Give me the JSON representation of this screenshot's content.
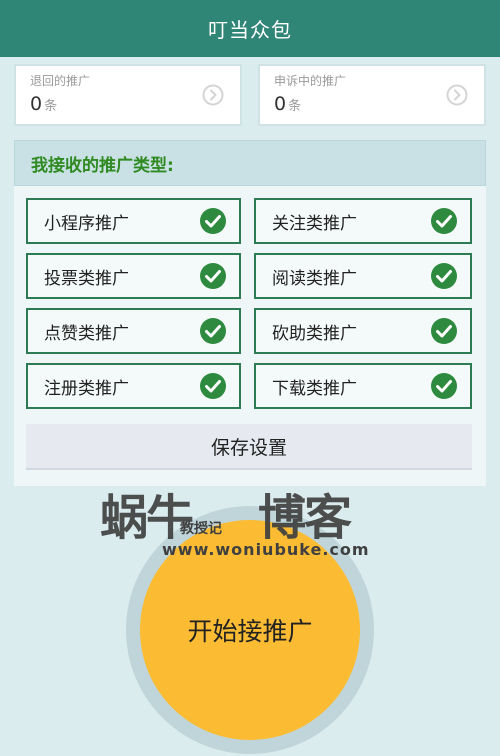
{
  "app": {
    "title": "叮当众包"
  },
  "stats": [
    {
      "label": "退回的推广",
      "value": "0",
      "unit": "条"
    },
    {
      "label": "申诉中的推广",
      "value": "0",
      "unit": "条"
    }
  ],
  "panel": {
    "title": "我接收的推广类型:",
    "types": [
      {
        "label": "小程序推广",
        "checked": true
      },
      {
        "label": "关注类推广",
        "checked": true
      },
      {
        "label": "投票类推广",
        "checked": true
      },
      {
        "label": "阅读类推广",
        "checked": true
      },
      {
        "label": "点赞类推广",
        "checked": true
      },
      {
        "label": "砍助类推广",
        "checked": true
      },
      {
        "label": "注册类推广",
        "checked": true
      },
      {
        "label": "下载类推广",
        "checked": true
      }
    ],
    "save_label": "保存设置"
  },
  "watermark": {
    "text_left": "蜗牛",
    "text_right": "博客",
    "small": "教授记",
    "url": "www.woniubuke.com"
  },
  "start_button": {
    "label": "开始接推广"
  },
  "colors": {
    "header": "#2f8576",
    "panel_title": "#2f8a22",
    "check": "#2d8a3e",
    "start": "#fbbc33"
  },
  "icons": {
    "arrow": "chevron-right-circle-icon",
    "check": "check-circle-icon"
  }
}
